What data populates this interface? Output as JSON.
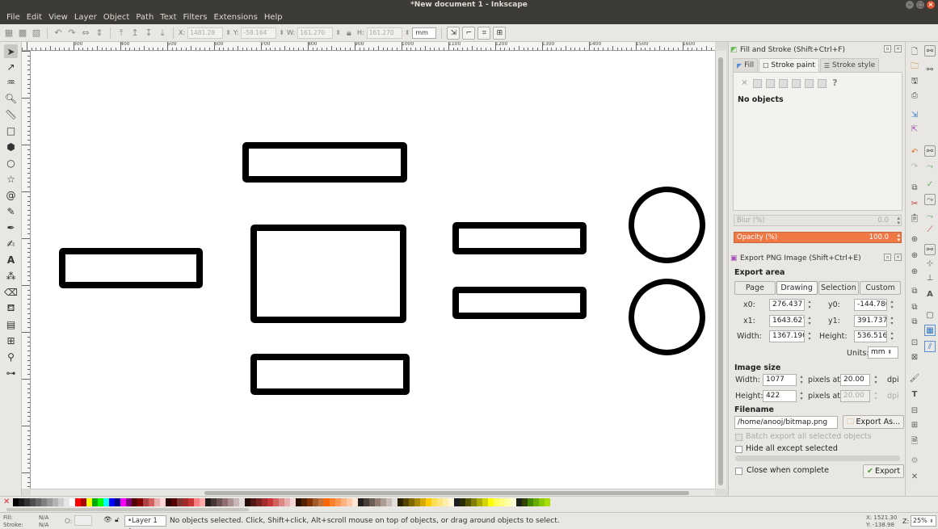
{
  "window": {
    "title": "*New document 1 - Inkscape"
  },
  "menu": [
    "File",
    "Edit",
    "View",
    "Layer",
    "Object",
    "Path",
    "Text",
    "Filters",
    "Extensions",
    "Help"
  ],
  "toolbar": {
    "x_label": "X:",
    "x_value": "1481.28",
    "y_label": "Y:",
    "y_value": "-58.164",
    "w_label": "W:",
    "w_value": "161.270",
    "h_label": "H:",
    "h_value": "161.270",
    "unit": "mm"
  },
  "ruler": {
    "top_labels": [
      "300",
      "400",
      "500",
      "600",
      "700",
      "800",
      "900",
      "1000",
      "1100",
      "1200",
      "1300",
      "1400",
      "1500",
      "1600"
    ]
  },
  "fill_stroke": {
    "title": "Fill and Stroke (Shift+Ctrl+F)",
    "tabs": [
      "Fill",
      "Stroke paint",
      "Stroke style"
    ],
    "no_objects": "No objects",
    "blur_label": "Blur (%)",
    "blur_value": "0.0",
    "opacity_label": "Opacity (%)",
    "opacity_value": "100.0"
  },
  "export": {
    "title": "Export PNG Image (Shift+Ctrl+E)",
    "area_label": "Export area",
    "area_buttons": [
      "Page",
      "Drawing",
      "Selection",
      "Custom"
    ],
    "x0_label": "x0:",
    "x0": "276.437",
    "y0_label": "y0:",
    "y0": "-144.780",
    "x1_label": "x1:",
    "x1": "1643.627",
    "y1_label": "y1:",
    "y1": "391.737",
    "width_label": "Width:",
    "width": "1367.190",
    "height_label": "Height:",
    "height": "536.516",
    "units_label": "Units:",
    "units": "mm",
    "image_size_label": "Image size",
    "img_width_label": "Width:",
    "img_width": "1077",
    "img_height_label": "Height:",
    "img_height": "422",
    "pixels_at": "pixels at",
    "dpi_value": "20.00",
    "dpi_value_disabled": "20.00",
    "dpi": "dpi",
    "filename_label": "Filename",
    "filename": "/home/anooj/bitmap.png",
    "export_as": "Export As...",
    "batch_label": "Batch export all selected objects",
    "hide_label": "Hide all except selected",
    "close_label": "Close when complete",
    "export_button": "Export"
  },
  "status": {
    "fill_label": "Fill:",
    "fill_value": "N/A",
    "stroke_label": "Stroke:",
    "stroke_value": "N/A",
    "opacity_label": "O:",
    "layer": "•Layer 1",
    "message": "No objects selected. Click, Shift+click, Alt+scroll mouse on top of objects, or drag around objects to select.",
    "x_readout": "X: 1521.30",
    "y_readout": "Y: -138.98",
    "zoom_label": "Z:",
    "zoom": "25%"
  },
  "palette_colors": [
    "#000000",
    "#1a1a1a",
    "#333333",
    "#4d4d4d",
    "#666666",
    "#808080",
    "#999999",
    "#b3b3b3",
    "#cccccc",
    "#e6e6e6",
    "#ffffff",
    "#ff0000",
    "#aa0000",
    "#ffff00",
    "#00aa00",
    "#00ff00",
    "#00ffff",
    "#0000ff",
    "#000080",
    "#ff00ff",
    "#800080",
    "#550000",
    "#800000",
    "#aa4444",
    "#d35f5f",
    "#e9afaf",
    "#ffd5d5",
    "#2b0000",
    "#550000",
    "#803333",
    "#a02c2c",
    "#c83737",
    "#ff8080",
    "#ffaaaa",
    "#241c1c",
    "#483737",
    "#6c5353",
    "#916f6f",
    "#ac9393",
    "#c8b7b7",
    "#e3dbdb",
    "#280b0b",
    "#501616",
    "#782121",
    "#a02c2c",
    "#c83737",
    "#d35f5f",
    "#de8787",
    "#e9afaf",
    "#f4d7d7",
    "#2b1100",
    "#552200",
    "#803300",
    "#a05a2c",
    "#c87137",
    "#ff6600",
    "#ff7f2a",
    "#ff9955",
    "#ffb380",
    "#ffccaa",
    "#ffe6d5",
    "#241f1c",
    "#483e37",
    "#6c5d53",
    "#917c6f",
    "#ac9d93",
    "#c8beb7",
    "#e3dedb",
    "#2b2200",
    "#554400",
    "#806600",
    "#aa8800",
    "#d4aa00",
    "#ffcc00",
    "#ffdd55",
    "#ffe680",
    "#ffeeaa",
    "#fff6d5",
    "#1c1c24",
    "#2b2b00",
    "#555500",
    "#808000",
    "#aaaa00",
    "#d4d400",
    "#ffff00",
    "#ffff55",
    "#ffff80",
    "#ffffaa",
    "#ffffd5",
    "#1c241c",
    "#334400",
    "#448800",
    "#66aa00",
    "#88cc00",
    "#aade00"
  ]
}
